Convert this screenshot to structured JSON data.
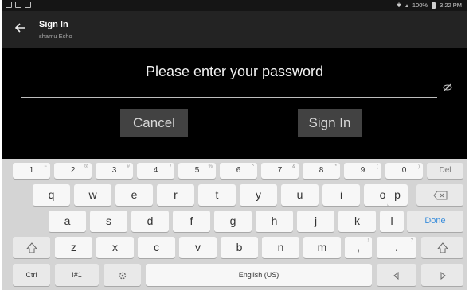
{
  "status_bar": {
    "left_icons": [
      "settings-icon",
      "notification-icon",
      "image-icon"
    ],
    "right_text": "100%",
    "time": "3:22 PM"
  },
  "app_bar": {
    "title": "Sign In",
    "subtitle": "shamu Echo",
    "back_icon": "arrow-left-icon"
  },
  "dialog": {
    "prompt": "Please enter your password",
    "password_value": "",
    "visibility_icon": "eye-off-icon",
    "cancel_label": "Cancel",
    "signin_label": "Sign In"
  },
  "keyboard": {
    "number_row": [
      {
        "label": "1",
        "alt": "~"
      },
      {
        "label": "2",
        "alt": "@"
      },
      {
        "label": "3",
        "alt": "#"
      },
      {
        "label": "4",
        "alt": "/"
      },
      {
        "label": "5",
        "alt": "%"
      },
      {
        "label": "6",
        "alt": "^"
      },
      {
        "label": "7",
        "alt": "&"
      },
      {
        "label": "8",
        "alt": "*"
      },
      {
        "label": "9",
        "alt": "("
      },
      {
        "label": "0",
        "alt": ")"
      },
      {
        "label": "Del",
        "alt": ""
      }
    ],
    "row_q": [
      "q",
      "w",
      "e",
      "r",
      "t",
      "y",
      "u",
      "i",
      "o",
      "p"
    ],
    "row_a": [
      "a",
      "s",
      "d",
      "f",
      "g",
      "h",
      "j",
      "k",
      "l"
    ],
    "row_z": [
      "z",
      "x",
      "c",
      "v",
      "b",
      "n",
      "m",
      ",",
      "."
    ],
    "row_z_alt": [
      "",
      "",
      "",
      "",
      "",
      "",
      "",
      "!",
      "?"
    ],
    "done_label": "Done",
    "ctrl_label": "Ctrl",
    "symbols_label": "!#1",
    "space_label": "English (US)",
    "icons": {
      "backspace": "backspace-icon",
      "shift": "shift-icon",
      "settings": "gear-icon",
      "left": "arrow-left-icon",
      "right": "arrow-right-icon"
    }
  }
}
